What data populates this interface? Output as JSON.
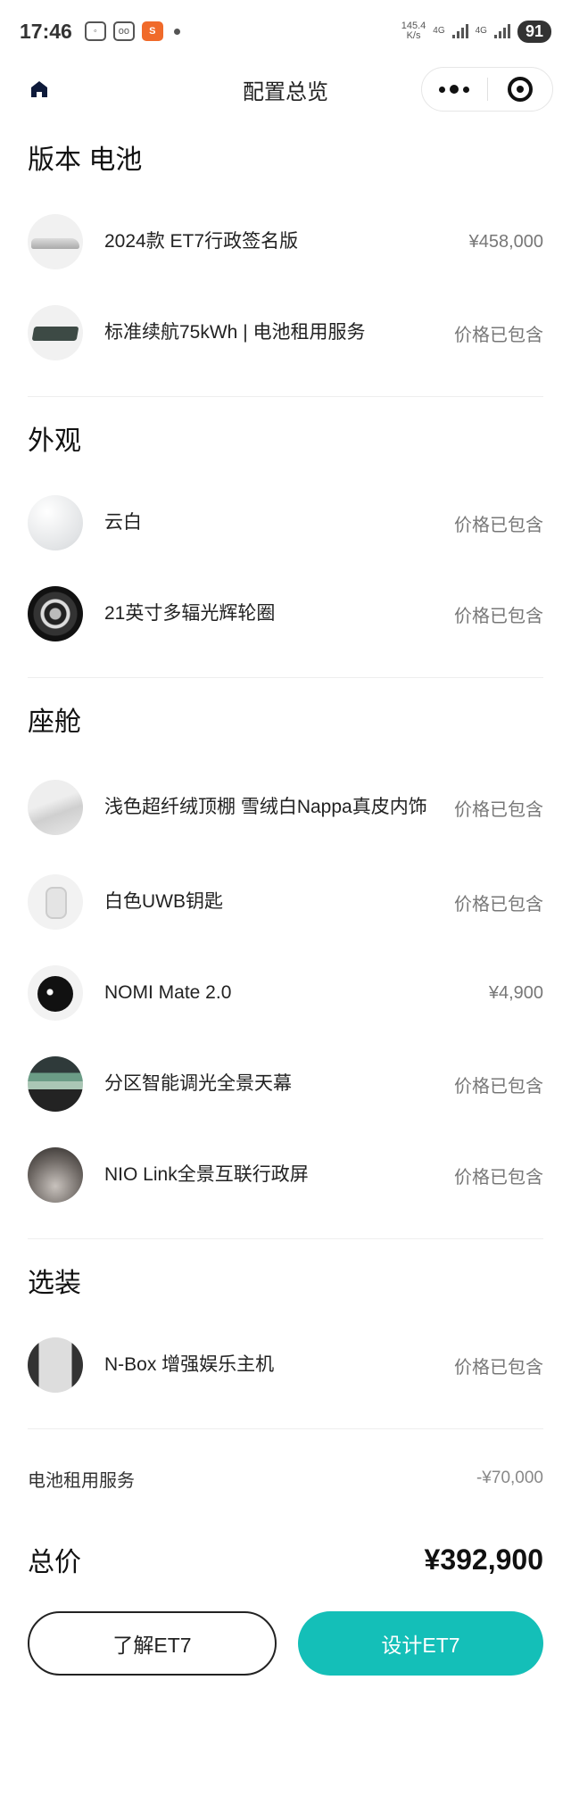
{
  "statusbar": {
    "time": "17:46",
    "net_speed": "145.4",
    "net_speed_unit": "K/s",
    "net1": "4G",
    "net2": "4G",
    "battery": "91"
  },
  "navbar": {
    "title": "配置总览",
    "home_icon": "home-icon",
    "menu_icon": "more-dots-icon",
    "close_icon": "close-capsule-icon"
  },
  "sections": [
    {
      "title": "版本 电池",
      "items": [
        {
          "name": "2024款 ET7行政签名版",
          "price": "¥458,000",
          "thumb": "car-thumbnail"
        },
        {
          "name": "标准续航75kWh | 电池租用服务",
          "price": "价格已包含",
          "thumb": "battery-thumbnail"
        }
      ]
    },
    {
      "title": "外观",
      "items": [
        {
          "name": "云白",
          "price": "价格已包含",
          "thumb": "white-paint-thumbnail"
        },
        {
          "name": "21英寸多辐光辉轮圈",
          "price": "价格已包含",
          "thumb": "wheel-thumbnail"
        }
      ]
    },
    {
      "title": "座舱",
      "items": [
        {
          "name": "浅色超纤绒顶棚 雪绒白Nappa真皮内饰",
          "price": "价格已包含",
          "thumb": "interior-thumbnail"
        },
        {
          "name": "白色UWB钥匙",
          "price": "价格已包含",
          "thumb": "key-thumbnail"
        },
        {
          "name": "NOMI Mate 2.0",
          "price": "¥4,900",
          "thumb": "nomi-thumbnail"
        },
        {
          "name": "分区智能调光全景天幕",
          "price": "价格已包含",
          "thumb": "sky-roof-thumbnail"
        },
        {
          "name": "NIO Link全景互联行政屏",
          "price": "价格已包含",
          "thumb": "screen-thumbnail"
        }
      ]
    },
    {
      "title": "选装",
      "items": [
        {
          "name": "N-Box 增强娱乐主机",
          "price": "价格已包含",
          "thumb": "nbox-thumbnail"
        }
      ]
    }
  ],
  "summary": {
    "rental_label": "电池租用服务",
    "rental_value": "-¥70,000",
    "total_label": "总价",
    "total_value": "¥392,900"
  },
  "buttons": {
    "learn": "了解ET7",
    "design": "设计ET7"
  },
  "colors": {
    "primary": "#14bfb8",
    "text": "#222222",
    "muted": "#777777"
  }
}
